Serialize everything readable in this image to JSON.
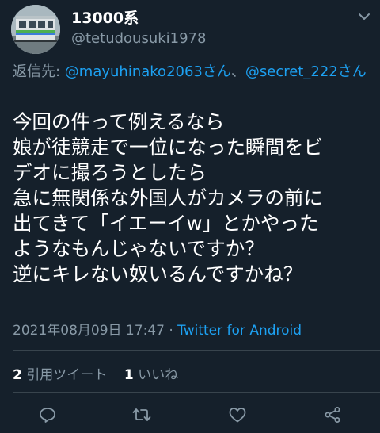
{
  "user": {
    "display_name": "13000系",
    "handle": "@tetudousuki1978"
  },
  "reply": {
    "prefix": "返信先: ",
    "mention1": "@mayuhinako2063さん",
    "separator": "、",
    "mention2": "@secret_222さん"
  },
  "tweet": {
    "lines": [
      "今回の件って例えるなら",
      "娘が徒競走で一位になった瞬間をビ",
      "デオに撮ろうとしたら",
      "急に無関係な外国人がカメラの前に",
      "出てきて「イエーイw」とかやった",
      "ようなもんじゃないですか？",
      "逆にキレない奴いるんですかね？"
    ]
  },
  "meta": {
    "timestamp": "2021年08月09日 17:47",
    "separator": " · ",
    "source": "Twitter for Android"
  },
  "stats": {
    "retweets_count": "2",
    "retweets_label": "引用ツイート",
    "likes_count": "1",
    "likes_label": "いいね"
  },
  "icons": {
    "more": "more-icon",
    "reply": "reply-icon",
    "retweet": "retweet-icon",
    "like": "like-icon",
    "share": "share-icon"
  },
  "colors": {
    "background": "#15202b",
    "accent": "#1da1f2",
    "secondary_text": "#8899a6",
    "divider": "#38444d"
  }
}
